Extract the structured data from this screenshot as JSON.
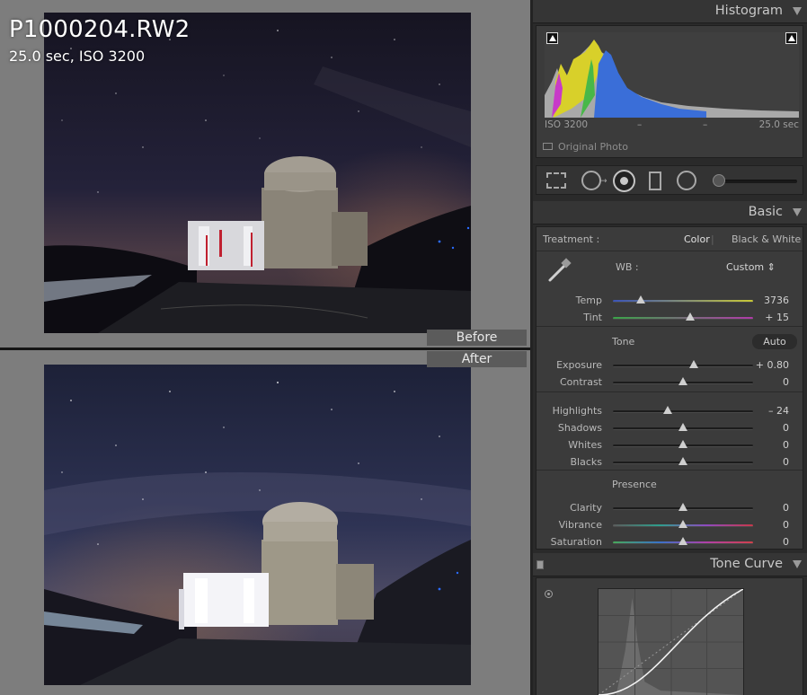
{
  "file": {
    "name": "P1000204.RW2",
    "meta": "25.0 sec, ISO 3200"
  },
  "view": {
    "before_label": "Before",
    "after_label": "After"
  },
  "histogram": {
    "title": "Histogram",
    "iso": "ISO 3200",
    "dash1": "–",
    "dash2": "–",
    "shutter": "25.0 sec",
    "original_photo": "Original Photo"
  },
  "basic": {
    "title": "Basic",
    "treatment_label": "Treatment :",
    "treatment_color": "Color",
    "treatment_sep": "|",
    "treatment_bw": "Black & White",
    "wb_label": "WB :",
    "wb_value": "Custom ⇕",
    "tone_label": "Tone",
    "auto_label": "Auto",
    "presence_label": "Presence",
    "sliders": [
      {
        "label": "Temp",
        "value": "3736",
        "pos": 0.2
      },
      {
        "label": "Tint",
        "value": "+ 15",
        "pos": 0.55
      },
      {
        "label": "Exposure",
        "value": "+ 0.80",
        "pos": 0.58
      },
      {
        "label": "Contrast",
        "value": "0",
        "pos": 0.5
      },
      {
        "label": "Highlights",
        "value": "– 24",
        "pos": 0.39
      },
      {
        "label": "Shadows",
        "value": "0",
        "pos": 0.5
      },
      {
        "label": "Whites",
        "value": "0",
        "pos": 0.5
      },
      {
        "label": "Blacks",
        "value": "0",
        "pos": 0.5
      },
      {
        "label": "Clarity",
        "value": "0",
        "pos": 0.5
      },
      {
        "label": "Vibrance",
        "value": "0",
        "pos": 0.5
      },
      {
        "label": "Saturation",
        "value": "0",
        "pos": 0.5
      }
    ]
  },
  "tone_curve": {
    "title": "Tone Curve"
  },
  "colors": {
    "panel_bg": "#3b3b3b",
    "accent_text": "#e2e2e2"
  }
}
